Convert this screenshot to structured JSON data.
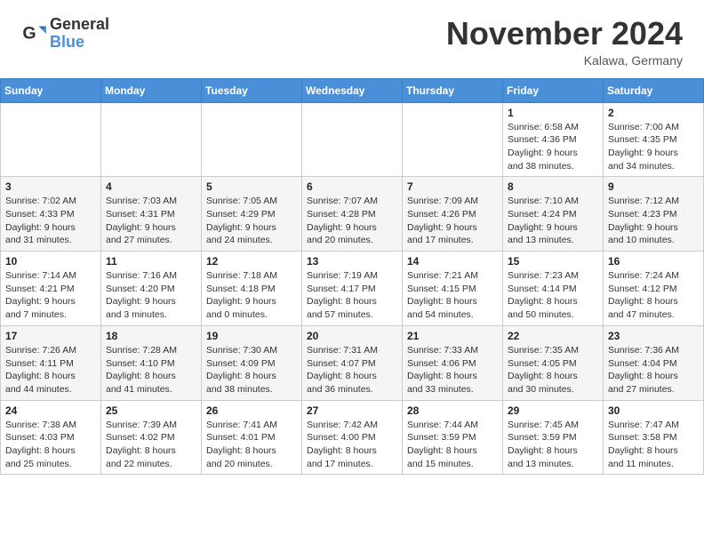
{
  "logo": {
    "text_general": "General",
    "text_blue": "Blue"
  },
  "header": {
    "month_title": "November 2024",
    "location": "Kalawa, Germany"
  },
  "days_of_week": [
    "Sunday",
    "Monday",
    "Tuesday",
    "Wednesday",
    "Thursday",
    "Friday",
    "Saturday"
  ],
  "weeks": [
    [
      {
        "day": "",
        "info": ""
      },
      {
        "day": "",
        "info": ""
      },
      {
        "day": "",
        "info": ""
      },
      {
        "day": "",
        "info": ""
      },
      {
        "day": "",
        "info": ""
      },
      {
        "day": "1",
        "info": "Sunrise: 6:58 AM\nSunset: 4:36 PM\nDaylight: 9 hours\nand 38 minutes."
      },
      {
        "day": "2",
        "info": "Sunrise: 7:00 AM\nSunset: 4:35 PM\nDaylight: 9 hours\nand 34 minutes."
      }
    ],
    [
      {
        "day": "3",
        "info": "Sunrise: 7:02 AM\nSunset: 4:33 PM\nDaylight: 9 hours\nand 31 minutes."
      },
      {
        "day": "4",
        "info": "Sunrise: 7:03 AM\nSunset: 4:31 PM\nDaylight: 9 hours\nand 27 minutes."
      },
      {
        "day": "5",
        "info": "Sunrise: 7:05 AM\nSunset: 4:29 PM\nDaylight: 9 hours\nand 24 minutes."
      },
      {
        "day": "6",
        "info": "Sunrise: 7:07 AM\nSunset: 4:28 PM\nDaylight: 9 hours\nand 20 minutes."
      },
      {
        "day": "7",
        "info": "Sunrise: 7:09 AM\nSunset: 4:26 PM\nDaylight: 9 hours\nand 17 minutes."
      },
      {
        "day": "8",
        "info": "Sunrise: 7:10 AM\nSunset: 4:24 PM\nDaylight: 9 hours\nand 13 minutes."
      },
      {
        "day": "9",
        "info": "Sunrise: 7:12 AM\nSunset: 4:23 PM\nDaylight: 9 hours\nand 10 minutes."
      }
    ],
    [
      {
        "day": "10",
        "info": "Sunrise: 7:14 AM\nSunset: 4:21 PM\nDaylight: 9 hours\nand 7 minutes."
      },
      {
        "day": "11",
        "info": "Sunrise: 7:16 AM\nSunset: 4:20 PM\nDaylight: 9 hours\nand 3 minutes."
      },
      {
        "day": "12",
        "info": "Sunrise: 7:18 AM\nSunset: 4:18 PM\nDaylight: 9 hours\nand 0 minutes."
      },
      {
        "day": "13",
        "info": "Sunrise: 7:19 AM\nSunset: 4:17 PM\nDaylight: 8 hours\nand 57 minutes."
      },
      {
        "day": "14",
        "info": "Sunrise: 7:21 AM\nSunset: 4:15 PM\nDaylight: 8 hours\nand 54 minutes."
      },
      {
        "day": "15",
        "info": "Sunrise: 7:23 AM\nSunset: 4:14 PM\nDaylight: 8 hours\nand 50 minutes."
      },
      {
        "day": "16",
        "info": "Sunrise: 7:24 AM\nSunset: 4:12 PM\nDaylight: 8 hours\nand 47 minutes."
      }
    ],
    [
      {
        "day": "17",
        "info": "Sunrise: 7:26 AM\nSunset: 4:11 PM\nDaylight: 8 hours\nand 44 minutes."
      },
      {
        "day": "18",
        "info": "Sunrise: 7:28 AM\nSunset: 4:10 PM\nDaylight: 8 hours\nand 41 minutes."
      },
      {
        "day": "19",
        "info": "Sunrise: 7:30 AM\nSunset: 4:09 PM\nDaylight: 8 hours\nand 38 minutes."
      },
      {
        "day": "20",
        "info": "Sunrise: 7:31 AM\nSunset: 4:07 PM\nDaylight: 8 hours\nand 36 minutes."
      },
      {
        "day": "21",
        "info": "Sunrise: 7:33 AM\nSunset: 4:06 PM\nDaylight: 8 hours\nand 33 minutes."
      },
      {
        "day": "22",
        "info": "Sunrise: 7:35 AM\nSunset: 4:05 PM\nDaylight: 8 hours\nand 30 minutes."
      },
      {
        "day": "23",
        "info": "Sunrise: 7:36 AM\nSunset: 4:04 PM\nDaylight: 8 hours\nand 27 minutes."
      }
    ],
    [
      {
        "day": "24",
        "info": "Sunrise: 7:38 AM\nSunset: 4:03 PM\nDaylight: 8 hours\nand 25 minutes."
      },
      {
        "day": "25",
        "info": "Sunrise: 7:39 AM\nSunset: 4:02 PM\nDaylight: 8 hours\nand 22 minutes."
      },
      {
        "day": "26",
        "info": "Sunrise: 7:41 AM\nSunset: 4:01 PM\nDaylight: 8 hours\nand 20 minutes."
      },
      {
        "day": "27",
        "info": "Sunrise: 7:42 AM\nSunset: 4:00 PM\nDaylight: 8 hours\nand 17 minutes."
      },
      {
        "day": "28",
        "info": "Sunrise: 7:44 AM\nSunset: 3:59 PM\nDaylight: 8 hours\nand 15 minutes."
      },
      {
        "day": "29",
        "info": "Sunrise: 7:45 AM\nSunset: 3:59 PM\nDaylight: 8 hours\nand 13 minutes."
      },
      {
        "day": "30",
        "info": "Sunrise: 7:47 AM\nSunset: 3:58 PM\nDaylight: 8 hours\nand 11 minutes."
      }
    ]
  ]
}
